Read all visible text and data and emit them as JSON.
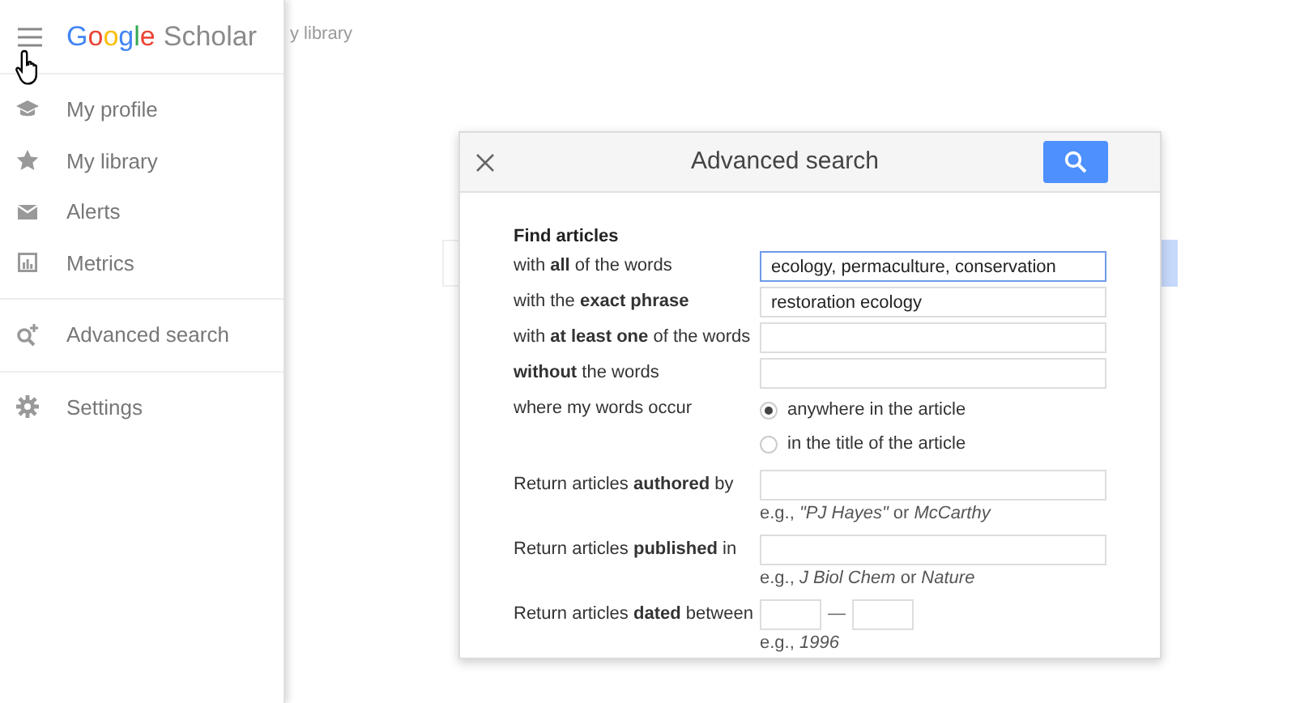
{
  "sidebar": {
    "logo": {
      "brand": "Google",
      "product": "Scholar"
    },
    "sections": [
      {
        "items": [
          {
            "label": "My profile"
          },
          {
            "label": "My library"
          },
          {
            "label": "Alerts"
          },
          {
            "label": "Metrics"
          }
        ]
      },
      {
        "items": [
          {
            "label": "Advanced search"
          }
        ]
      },
      {
        "items": [
          {
            "label": "Settings"
          }
        ]
      }
    ]
  },
  "page": {
    "header_link": "y library"
  },
  "dialog": {
    "title": "Advanced search",
    "section_title": "Find articles",
    "rows": [
      {
        "kind": "text",
        "label": "with **all** of the words",
        "value": "ecology, permaculture, conservation",
        "focused": true
      },
      {
        "kind": "text",
        "label": "with the **exact phrase**",
        "value": "restoration ecology",
        "focused": false
      },
      {
        "kind": "text",
        "label": "with **at least one** of the words",
        "focused": false
      },
      {
        "kind": "text",
        "label": "**without** the words",
        "focused": false
      },
      {
        "kind": "radio",
        "label": "where my words occur",
        "options": [
          {
            "label": "anywhere in the article",
            "selected": true
          },
          {
            "label": "in the title of the article",
            "selected": false
          }
        ]
      },
      {
        "kind": "text",
        "label": "Return articles **authored** by",
        "hint": "e.g., *\"PJ Hayes\"* or *McCarthy*",
        "focused": false
      },
      {
        "kind": "text",
        "label": "Return articles **published** in",
        "hint": "e.g., *J Biol Chem* or *Nature*",
        "focused": false
      },
      {
        "kind": "range",
        "label": "Return articles **dated** between",
        "separator": "—",
        "hint": "e.g., *1996*"
      }
    ]
  }
}
